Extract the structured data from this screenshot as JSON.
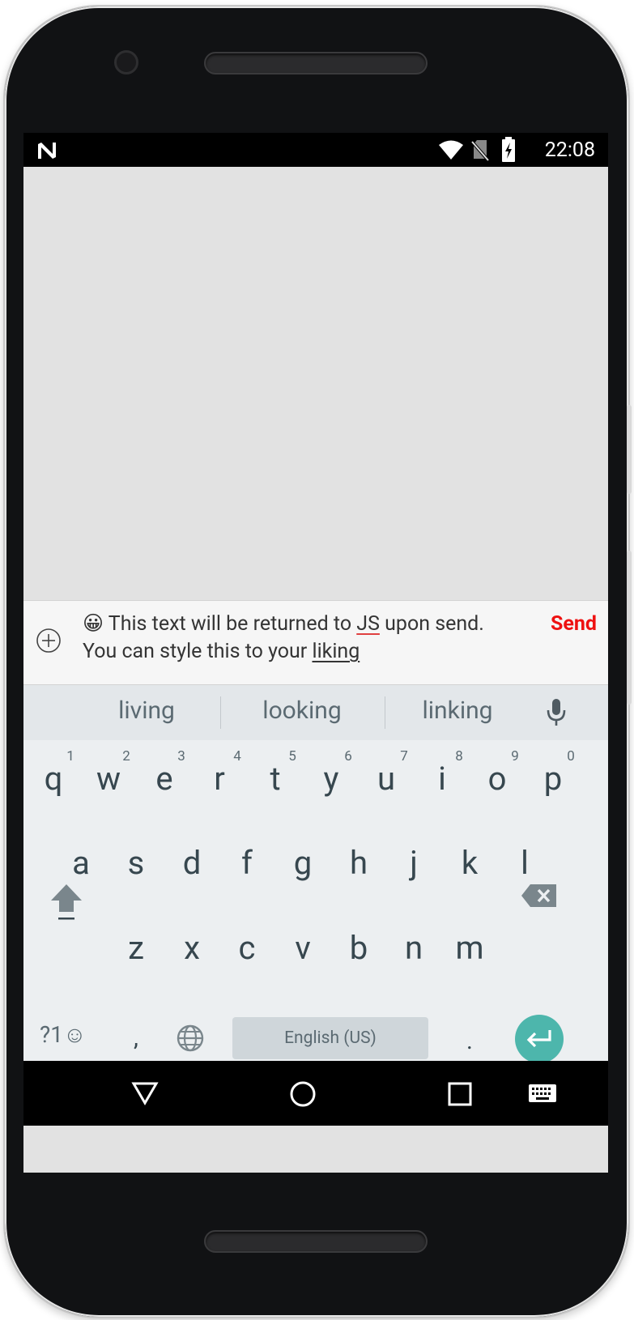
{
  "status_bar": {
    "time": "22:08"
  },
  "input_bar": {
    "emoji": "😀",
    "text_a": "This text will be returned to ",
    "word_js": "JS",
    "text_b": " upon send. You can style this to your ",
    "word_liking": "liking",
    "send_label": "Send"
  },
  "keyboard": {
    "suggestions": [
      "living",
      "looking",
      "linking"
    ],
    "row1": [
      "q",
      "w",
      "e",
      "r",
      "t",
      "y",
      "u",
      "i",
      "o",
      "p"
    ],
    "row1_hints": [
      "1",
      "2",
      "3",
      "4",
      "5",
      "6",
      "7",
      "8",
      "9",
      "0"
    ],
    "row2": [
      "a",
      "s",
      "d",
      "f",
      "g",
      "h",
      "j",
      "k",
      "l"
    ],
    "row3": [
      "z",
      "x",
      "c",
      "v",
      "b",
      "n",
      "m"
    ],
    "symbols_label": "?1☺",
    "comma": ",",
    "period": ".",
    "space_label": "English (US)"
  },
  "colors": {
    "send": "#ee1111",
    "enter": "#4db6ac",
    "key_text": "#37474f"
  }
}
